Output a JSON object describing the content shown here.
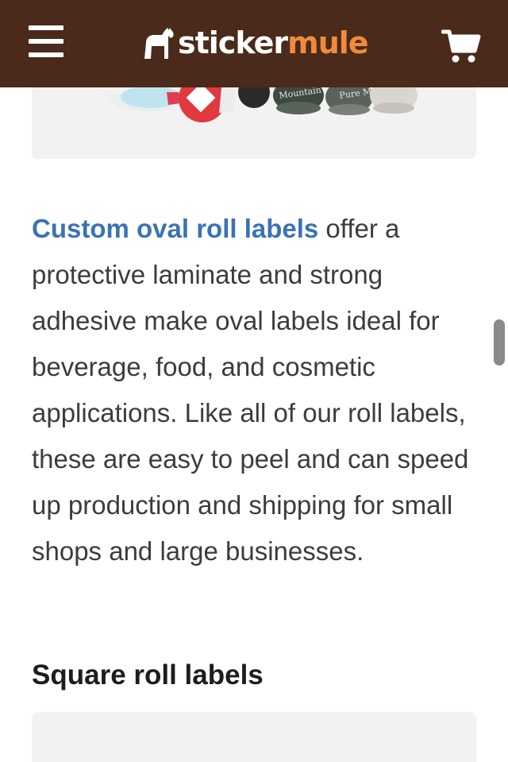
{
  "header": {
    "menu_icon": "hamburger-menu-icon",
    "logo_part1": "sticker",
    "logo_part2": "mule",
    "logo_icon": "mule-icon",
    "cart_icon": "shopping-cart-icon",
    "background": "#4a2a1a",
    "logo_accent": "#f08a3c"
  },
  "hero_card": {
    "image_text_1": "Mountain",
    "image_text_2": "Pure M"
  },
  "description": {
    "link_text": "Custom oval roll labels",
    "body": " offer a protective laminate and strong adhesive make oval labels ideal for beverage, food, and cosmetic applications. Like all of our roll labels, these are easy to peel and can speed up production and shipping for small shops and large businesses.",
    "link_color": "#3a73b4"
  },
  "next_section": {
    "title": "Square roll labels"
  }
}
